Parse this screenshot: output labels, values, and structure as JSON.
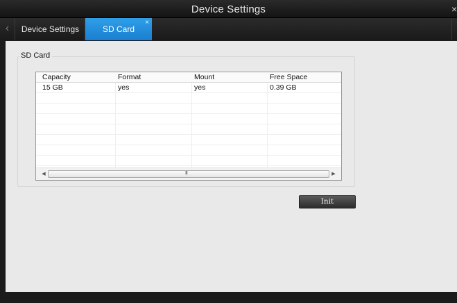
{
  "window": {
    "title": "Device Settings",
    "close_glyph": "×"
  },
  "tabs": [
    {
      "label": "Device Settings",
      "active": false
    },
    {
      "label": "SD Card",
      "active": true,
      "close_glyph": "×"
    }
  ],
  "tab_nav": {
    "left_glyph": "‹"
  },
  "sd_card": {
    "group_label": "SD Card",
    "columns": [
      "Capacity",
      "Format",
      "Mount",
      "Free Space"
    ],
    "rows": [
      [
        "15 GB",
        "yes",
        "yes",
        "0.39 GB"
      ]
    ],
    "scroll_left_glyph": "◀",
    "scroll_right_glyph": "▶",
    "scroll_grip": "III"
  },
  "actions": {
    "init_label": "Init"
  },
  "colors": {
    "accent_tab": "#1f8ee0",
    "chrome_dark": "#1b1b1b",
    "content_bg": "#e9e9e9"
  },
  "icons": [
    "close-icon",
    "tab-close-icon",
    "chevron-left-icon",
    "scroll-left-arrow-icon",
    "scroll-right-arrow-icon"
  ]
}
